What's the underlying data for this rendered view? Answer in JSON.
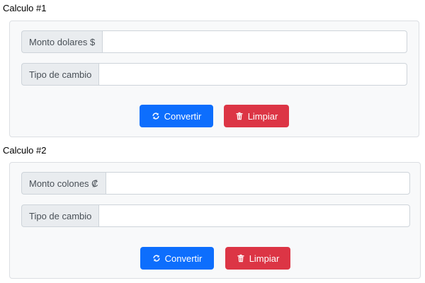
{
  "calc1": {
    "title": "Calculo #1",
    "amount_label": "Monto dolares $",
    "amount_value": "",
    "rate_label": "Tipo de cambio",
    "rate_value": "",
    "convert_label": "Convertir",
    "clear_label": "Limpiar"
  },
  "calc2": {
    "title": "Calculo #2",
    "amount_label": "Monto colones ₡",
    "amount_value": "",
    "rate_label": "Tipo de cambio",
    "rate_value": "",
    "convert_label": "Convertir",
    "clear_label": "Limpiar"
  },
  "icons": {
    "convert": "refresh-icon",
    "clear": "trash-icon"
  },
  "colors": {
    "primary": "#0d6efd",
    "danger": "#dc3545",
    "card_bg": "#f8f9fa",
    "label_bg": "#e9ecef"
  }
}
